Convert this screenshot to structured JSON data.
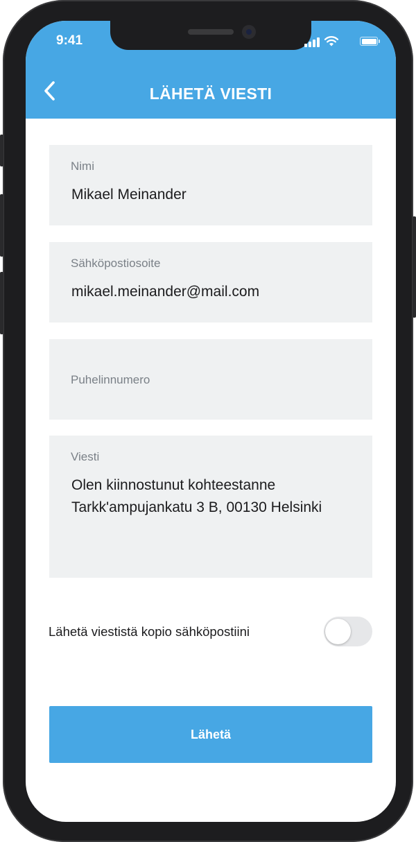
{
  "status_bar": {
    "time": "9:41"
  },
  "header": {
    "title": "LÄHETÄ VIESTI"
  },
  "form": {
    "name": {
      "label": "Nimi",
      "value": "Mikael Meinander"
    },
    "email": {
      "label": "Sähköpostiosoite",
      "value": "mikael.meinander@mail.com"
    },
    "phone": {
      "label": "Puhelinnumero",
      "value": ""
    },
    "message": {
      "label": "Viesti",
      "value": "Olen kiinnostunut kohteestanne\nTarkk'ampujankatu 3 B, 00130 Helsinki"
    },
    "copy_toggle": {
      "label": "Lähetä viestistä kopio sähköpostiini",
      "on": false
    },
    "submit_label": "Lähetä"
  },
  "colors": {
    "accent": "#47a7e4",
    "field_background": "#eff1f2",
    "label_text": "#7a8087",
    "toggle_off": "#e6e7e9"
  }
}
